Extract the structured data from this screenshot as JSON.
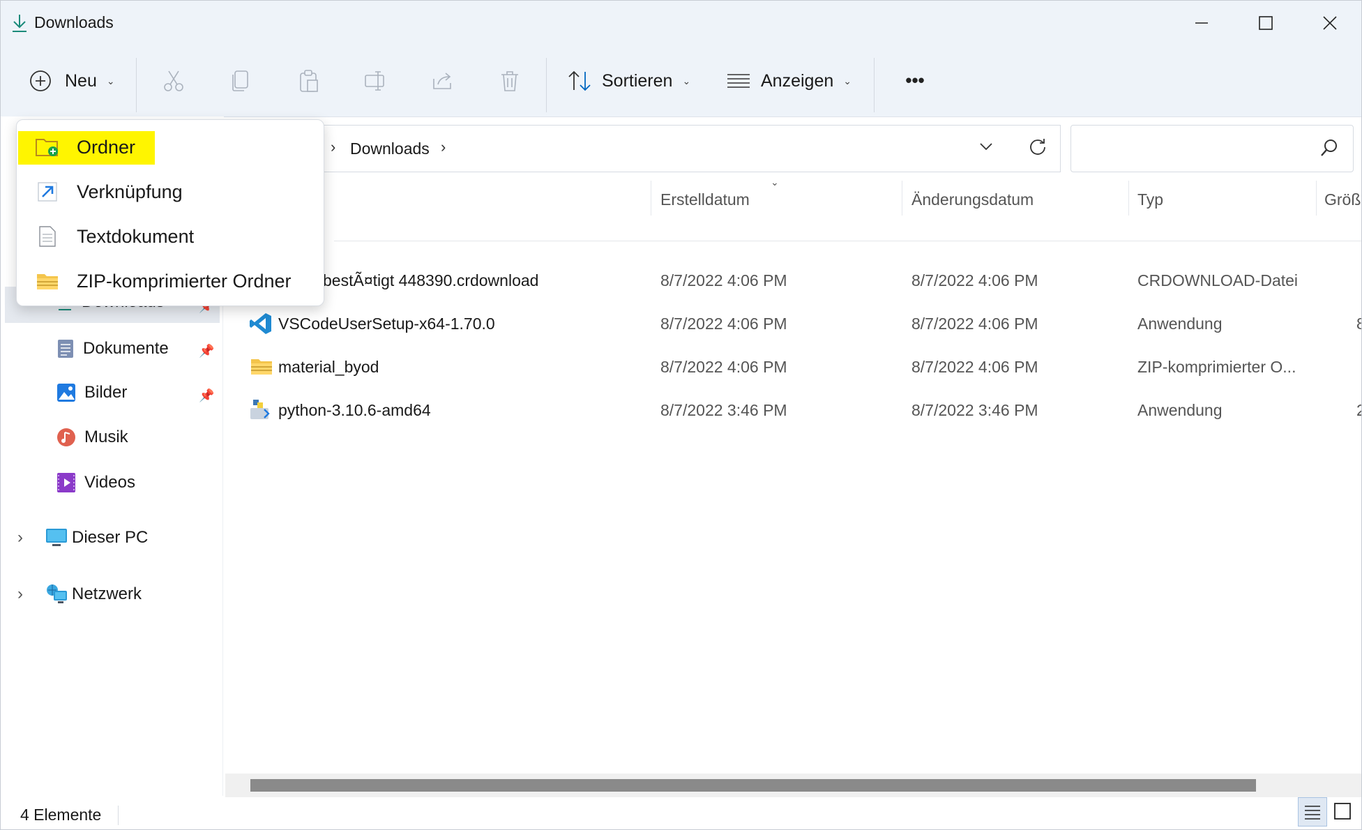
{
  "window": {
    "title": "Downloads",
    "title_icon": "download-arrow-icon",
    "controls": [
      "minimize",
      "maximize",
      "close"
    ]
  },
  "toolbar": {
    "new_label": "Neu",
    "sort_label": "Sortieren",
    "view_label": "Anzeigen",
    "icons": [
      "cut-icon",
      "copy-icon",
      "paste-icon",
      "rename-icon",
      "share-icon",
      "delete-icon"
    ],
    "more_label": "•••"
  },
  "address": {
    "crumb": "Downloads",
    "search_placeholder": ""
  },
  "columns": {
    "name": "",
    "created": "Erstelldatum",
    "modified": "Änderungsdatum",
    "type": "Typ",
    "size": "Größ"
  },
  "files": [
    {
      "name": "bestÃ¤tigt 448390.crdownload",
      "created": "8/7/2022 4:06 PM",
      "modified": "8/7/2022 4:06 PM",
      "type": "CRDOWNLOAD-Datei",
      "size": "",
      "icon": "file-icon"
    },
    {
      "name": "VSCodeUserSetup-x64-1.70.0",
      "created": "8/7/2022 4:06 PM",
      "modified": "8/7/2022 4:06 PM",
      "type": "Anwendung",
      "size": "8",
      "icon": "vscode-icon"
    },
    {
      "name": "material_byod",
      "created": "8/7/2022 4:06 PM",
      "modified": "8/7/2022 4:06 PM",
      "type": "ZIP-komprimierter O...",
      "size": "",
      "icon": "zip-folder-icon"
    },
    {
      "name": "python-3.10.6-amd64",
      "created": "8/7/2022 3:46 PM",
      "modified": "8/7/2022 3:46 PM",
      "type": "Anwendung",
      "size": "2",
      "icon": "python-installer-icon"
    }
  ],
  "nav": {
    "items": [
      {
        "label": "Downloads",
        "icon": "download-arrow-icon",
        "pinned": true
      },
      {
        "label": "Dokumente",
        "icon": "document-icon",
        "pinned": true
      },
      {
        "label": "Bilder",
        "icon": "pictures-icon",
        "pinned": true
      },
      {
        "label": "Musik",
        "icon": "music-icon",
        "pinned": false
      },
      {
        "label": "Videos",
        "icon": "video-icon",
        "pinned": false
      }
    ],
    "groups": [
      {
        "label": "Dieser PC",
        "icon": "pc-icon"
      },
      {
        "label": "Netzwerk",
        "icon": "network-icon"
      }
    ]
  },
  "new_menu": {
    "items": [
      {
        "label": "Ordner",
        "icon": "new-folder-icon",
        "highlighted": true
      },
      {
        "label": "Verknüpfung",
        "icon": "shortcut-icon"
      },
      {
        "label": "Textdokument",
        "icon": "text-document-icon"
      },
      {
        "label": "ZIP-komprimierter Ordner",
        "icon": "zip-folder-icon"
      }
    ]
  },
  "status": {
    "count": "4 Elemente"
  },
  "colors": {
    "accent": "#0067c0",
    "highlight": "#fff500",
    "chrome": "#eef3f9"
  }
}
